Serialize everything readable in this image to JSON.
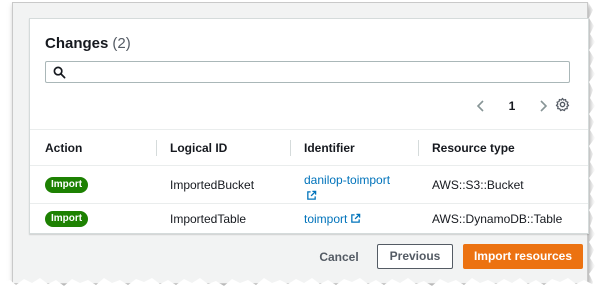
{
  "panel": {
    "title": "Changes",
    "count": "(2)"
  },
  "search": {
    "placeholder": "",
    "value": "",
    "icon": "search-icon"
  },
  "pagination": {
    "current_page": "1",
    "prev_icon": "chevron-left-icon",
    "next_icon": "chevron-right-icon",
    "settings_icon": "gear-icon"
  },
  "table": {
    "columns": [
      "Action",
      "Logical ID",
      "Identifier",
      "Resource type"
    ],
    "rows": [
      {
        "action": "Import",
        "logical_id": "ImportedBucket",
        "identifier": "danilop-toimport",
        "resource_type": "AWS::S3::Bucket"
      },
      {
        "action": "Import",
        "logical_id": "ImportedTable",
        "identifier": "toimport",
        "resource_type": "AWS::DynamoDB::Table"
      }
    ]
  },
  "footer": {
    "cancel_label": "Cancel",
    "previous_label": "Previous",
    "import_label": "Import resources"
  },
  "colors": {
    "badge_green": "#1d8102",
    "link_blue": "#0073bb",
    "primary_orange": "#ec7211"
  }
}
